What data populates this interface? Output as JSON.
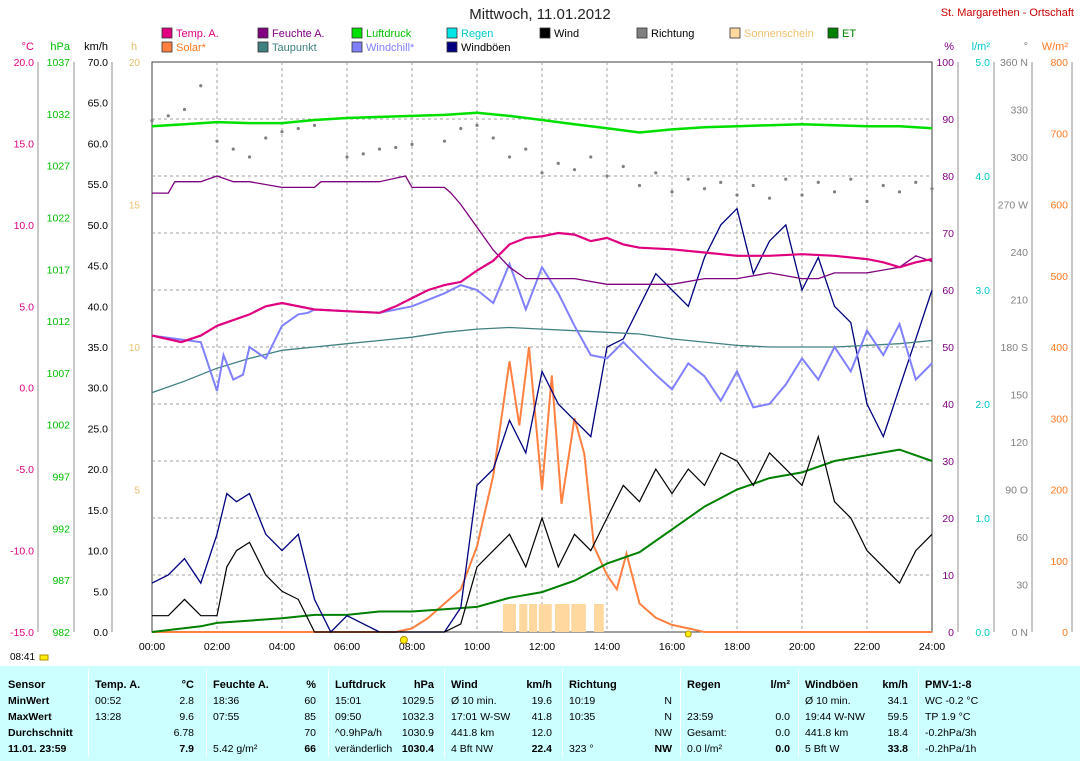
{
  "chart_data": {
    "type": "line",
    "title": "Mittwoch, 11.01.2012",
    "site": "St. Margarethen - Ortschaft",
    "x_ticks": [
      "00:00",
      "02:00",
      "04:00",
      "06:00",
      "08:00",
      "10:00",
      "12:00",
      "14:00",
      "16:00",
      "18:00",
      "20:00",
      "22:00",
      "24:00"
    ],
    "axes": {
      "temp_c": {
        "label": "°C",
        "ticks": [
          "20.0",
          "15.0",
          "10.0",
          "5.0",
          "0.0",
          "-5.0",
          "-10.0",
          "-15.0"
        ],
        "range": [
          -15,
          20
        ],
        "color": "#e0007f"
      },
      "pressure_hpa": {
        "label": "hPa",
        "ticks": [
          "1037",
          "1032",
          "1027",
          "1022",
          "1017",
          "1012",
          "1007",
          "1002",
          "997",
          "992",
          "987",
          "982"
        ],
        "range": [
          982,
          1040
        ],
        "color": "#00d000"
      },
      "wind_kmh": {
        "label": "km/h",
        "ticks": [
          "70.0",
          "65.0",
          "60.0",
          "55.0",
          "50.0",
          "45.0",
          "40.0",
          "35.0",
          "30.0",
          "25.0",
          "20.0",
          "15.0",
          "10.0",
          "5.0",
          "0.0"
        ],
        "range": [
          0,
          70
        ],
        "color": "#000000"
      },
      "sunshine": {
        "label": "h",
        "ticks": [
          "20",
          "15",
          "10",
          "5"
        ],
        "color": "#e8c070"
      },
      "humidity_pct": {
        "label": "%",
        "ticks": [
          "100",
          "90",
          "80",
          "70",
          "60",
          "50",
          "40",
          "30",
          "20",
          "10",
          "0"
        ],
        "range": [
          0,
          100
        ],
        "color": "#800080"
      },
      "rain_lm2": {
        "label": "l/m²",
        "ticks": [
          "5.0",
          "4.0",
          "3.0",
          "2.0",
          "1.0",
          "0.0"
        ],
        "range": [
          0,
          5
        ],
        "color": "#00c8c8"
      },
      "direction_deg": {
        "label": "°",
        "ticks": [
          "360 N",
          "330",
          "300",
          "270 W",
          "240",
          "210",
          "180 S",
          "150",
          "120",
          "90 O",
          "60",
          "30",
          "0 N"
        ],
        "range": [
          0,
          360
        ],
        "color": "#808080"
      },
      "solar_wm2": {
        "label": "W/m²",
        "ticks": [
          "800",
          "700",
          "600",
          "500",
          "400",
          "300",
          "200",
          "100",
          "0"
        ],
        "range": [
          0,
          800
        ],
        "color": "#ff7820"
      }
    },
    "legend": [
      {
        "name": "Temp. A.",
        "color": "#e0007f"
      },
      {
        "name": "Feuchte A.",
        "color": "#800080"
      },
      {
        "name": "Luftdruck",
        "color": "#00e000"
      },
      {
        "name": "Regen",
        "color": "#00e5e5"
      },
      {
        "name": "Wind",
        "color": "#000000"
      },
      {
        "name": "Richtung",
        "color": "#808080"
      },
      {
        "name": "Sonnenschein",
        "color": "#ffd8a0"
      },
      {
        "name": "ET",
        "color": "#008000"
      },
      {
        "name": "Solar*",
        "color": "#ff8040"
      },
      {
        "name": "Taupunkt",
        "color": "#408080"
      },
      {
        "name": "Windchill*",
        "color": "#8080ff"
      },
      {
        "name": "Windböen",
        "color": "#000080"
      }
    ],
    "series": [
      {
        "name": "Temp. A.",
        "unit": "°C",
        "x": [
          0,
          0.9,
          1.5,
          2,
          3,
          3.5,
          4,
          5,
          6,
          7,
          7.5,
          8,
          8.5,
          9,
          9.5,
          10,
          10.5,
          11,
          11.5,
          12,
          12.5,
          13,
          13.5,
          14,
          14.5,
          15,
          16,
          17,
          18,
          19,
          20,
          21,
          22,
          22.5,
          23,
          23.5,
          24
        ],
        "y": [
          3.2,
          2.8,
          3.2,
          3.8,
          4.5,
          5.0,
          5.2,
          4.8,
          4.7,
          4.6,
          5.0,
          5.5,
          6.0,
          6.3,
          6.5,
          7.2,
          7.8,
          8.8,
          9.2,
          9.3,
          9.5,
          9.4,
          9.0,
          9.2,
          8.8,
          8.6,
          8.5,
          8.3,
          8.1,
          8.1,
          8.2,
          8.1,
          7.9,
          7.7,
          7.4,
          7.7,
          7.9
        ]
      },
      {
        "name": "Feuchte A.",
        "unit": "%",
        "x": [
          0,
          0.5,
          0.7,
          1.5,
          2,
          2.5,
          3,
          4,
          5,
          5.2,
          5.5,
          6,
          7,
          7.8,
          8,
          8.5,
          9,
          9.2,
          9.5,
          10,
          10.5,
          11,
          11.5,
          12,
          13,
          14,
          15,
          16,
          17,
          18,
          19,
          20,
          20.5,
          21,
          22,
          23,
          23.5,
          24
        ],
        "y": [
          77,
          77,
          79,
          79,
          80,
          79,
          79,
          78,
          78,
          79,
          79,
          79,
          79,
          80,
          78,
          78,
          78,
          77,
          75,
          71,
          67,
          64,
          62,
          62,
          62,
          61,
          61,
          61,
          62,
          62,
          63,
          62,
          62,
          63,
          63,
          64,
          66,
          65
        ]
      },
      {
        "name": "Luftdruck",
        "unit": "hPa",
        "x": [
          0,
          1,
          2,
          3,
          4,
          5,
          6,
          7,
          8,
          9,
          10,
          11,
          12,
          13,
          14,
          15,
          16,
          17,
          18,
          19,
          20,
          21,
          22,
          23,
          24
        ],
        "y": [
          1030.8,
          1031.0,
          1031.2,
          1031.1,
          1031.1,
          1031.4,
          1031.6,
          1031.7,
          1031.8,
          1031.9,
          1032.1,
          1031.8,
          1031.4,
          1031.0,
          1030.6,
          1030.2,
          1030.5,
          1030.7,
          1030.8,
          1030.9,
          1031.0,
          1030.9,
          1030.8,
          1030.8,
          1030.6
        ]
      },
      {
        "name": "Taupunkt",
        "unit": "°C",
        "x": [
          0,
          1,
          2,
          3,
          4,
          5,
          6,
          7,
          8,
          9,
          10,
          11,
          12,
          13,
          14,
          15,
          16,
          17,
          18,
          19,
          20,
          21,
          22,
          23,
          24
        ],
        "y": [
          -0.3,
          0.4,
          1.2,
          1.8,
          2.3,
          2.5,
          2.7,
          2.9,
          3.1,
          3.4,
          3.6,
          3.7,
          3.6,
          3.5,
          3.4,
          3.3,
          3.0,
          2.8,
          2.6,
          2.5,
          2.5,
          2.5,
          2.6,
          2.7,
          2.9
        ]
      },
      {
        "name": "Windchill*",
        "unit": "°C",
        "x": [
          0,
          1.5,
          2,
          2.2,
          2.5,
          2.8,
          3,
          3.5,
          4,
          4.5,
          4.8,
          5,
          6,
          7,
          8,
          9,
          9.5,
          10,
          10.5,
          11,
          11.5,
          12,
          12.5,
          13,
          13.5,
          14,
          14.5,
          15,
          15.5,
          16,
          16.5,
          17,
          17.5,
          18,
          18.5,
          19,
          19.5,
          20,
          20.5,
          21,
          21.5,
          22,
          22.5,
          23,
          23.5,
          24
        ],
        "y": [
          3.2,
          2.8,
          -0.2,
          2.0,
          0.5,
          0.8,
          2.5,
          1.8,
          3.8,
          4.5,
          4.6,
          4.8,
          4.7,
          4.6,
          5.0,
          5.8,
          6.3,
          6.0,
          5.2,
          7.6,
          4.8,
          7.4,
          5.8,
          3.8,
          2.0,
          1.8,
          2.8,
          1.8,
          0.8,
          -0.1,
          1.5,
          0.7,
          -0.8,
          1.0,
          -1.2,
          -1.0,
          0.2,
          1.8,
          0.5,
          2.5,
          1.0,
          3.5,
          2.0,
          3.9,
          0.5,
          1.5
        ]
      },
      {
        "name": "Wind",
        "unit": "km/h",
        "x": [
          0,
          0.5,
          1,
          1.5,
          2,
          2.3,
          2.6,
          3,
          3.5,
          4,
          4.5,
          5,
          5.5,
          6,
          7,
          8,
          9,
          9.5,
          10,
          10.5,
          11,
          11.5,
          12,
          12.5,
          13,
          13.5,
          14,
          14.5,
          15,
          15.5,
          16,
          16.5,
          17,
          17.5,
          18,
          18.5,
          19,
          19.5,
          20,
          20.5,
          21,
          21.5,
          22,
          22.5,
          23,
          23.5,
          24
        ],
        "y": [
          2,
          2,
          4,
          2,
          2,
          8,
          10,
          11,
          7,
          5,
          4,
          0,
          0,
          0,
          0,
          0,
          0,
          1,
          8,
          10,
          12,
          8,
          14,
          8,
          12,
          10,
          14,
          18,
          16,
          20,
          17,
          20,
          18,
          22,
          21,
          18,
          22,
          20,
          18,
          24,
          16,
          14,
          10,
          8,
          6,
          10,
          12
        ]
      },
      {
        "name": "Windböen",
        "unit": "km/h",
        "x": [
          0,
          0.5,
          1,
          1.5,
          2,
          2.3,
          2.6,
          3,
          3.5,
          4,
          4.5,
          5,
          5.5,
          6,
          7,
          8,
          9,
          9.5,
          10,
          10.5,
          11,
          11.5,
          12,
          12.5,
          13,
          13.5,
          14,
          14.5,
          15,
          15.5,
          16,
          16.5,
          17,
          17.5,
          18,
          18.5,
          19,
          19.5,
          20,
          20.5,
          21,
          21.5,
          22,
          22.5,
          23,
          23.5,
          24
        ],
        "y": [
          6,
          7,
          9,
          6,
          12,
          17,
          16,
          17,
          12,
          10,
          12,
          4,
          0,
          2,
          0,
          0,
          0,
          3,
          18,
          20,
          26,
          22,
          32,
          28,
          26,
          24,
          35,
          36,
          40,
          44,
          42,
          40,
          46,
          50,
          52,
          44,
          48,
          50,
          42,
          46,
          40,
          38,
          28,
          24,
          30,
          36,
          42
        ]
      },
      {
        "name": "Richtung",
        "unit": "°",
        "x": [
          0,
          0.5,
          1,
          1.5,
          2,
          2.5,
          3,
          3.5,
          4,
          4.5,
          5,
          6,
          6.5,
          7,
          7.5,
          8,
          9,
          9.5,
          10,
          10.5,
          11,
          11.5,
          12,
          12.5,
          13,
          13.5,
          14,
          14.5,
          15,
          15.5,
          16,
          16.5,
          17,
          17.5,
          18,
          18.5,
          19,
          19.5,
          20,
          20.5,
          21,
          21.5,
          22,
          22.5,
          23,
          23.5,
          24
        ],
        "y": [
          323,
          326,
          330,
          345,
          310,
          305,
          300,
          312,
          316,
          318,
          320,
          300,
          302,
          305,
          306,
          308,
          310,
          318,
          320,
          312,
          300,
          305,
          290,
          296,
          292,
          300,
          288,
          294,
          282,
          290,
          278,
          286,
          280,
          284,
          276,
          282,
          274,
          286,
          276,
          284,
          278,
          286,
          272,
          282,
          278,
          284,
          280
        ]
      },
      {
        "name": "Solar*",
        "unit": "W/m²",
        "x": [
          0,
          7.5,
          8,
          8.5,
          9,
          9.5,
          10,
          10.5,
          11,
          11.3,
          11.6,
          12,
          12.3,
          12.6,
          13,
          13.3,
          13.6,
          14,
          14.3,
          14.6,
          15,
          15.5,
          16,
          16.5,
          17,
          18,
          24
        ],
        "y": [
          0,
          0,
          5,
          20,
          40,
          60,
          120,
          220,
          380,
          290,
          400,
          200,
          360,
          180,
          300,
          250,
          120,
          80,
          60,
          110,
          40,
          20,
          10,
          5,
          0,
          0,
          0
        ]
      },
      {
        "name": "ET",
        "unit": "l/m²",
        "x": [
          0,
          1.5,
          2,
          3,
          4,
          5,
          6,
          7,
          8,
          9,
          10,
          11,
          12,
          13,
          14,
          15,
          16,
          17,
          18,
          19,
          20,
          21,
          22,
          23,
          24
        ],
        "y": [
          0,
          0.05,
          0.08,
          0.1,
          0.12,
          0.15,
          0.15,
          0.18,
          0.18,
          0.2,
          0.22,
          0.3,
          0.35,
          0.45,
          0.6,
          0.7,
          0.9,
          1.1,
          1.25,
          1.35,
          1.4,
          1.5,
          1.55,
          1.6,
          1.5
        ]
      }
    ],
    "sunshine_bars": {
      "start_hours": [
        10.8,
        11.0,
        11.3,
        11.6,
        11.9,
        12.4,
        12.9,
        13.6
      ],
      "width_hours": [
        0.2,
        0.2,
        0.25,
        0.25,
        0.4,
        0.45,
        0.45,
        0.3
      ]
    }
  },
  "timestamp": "08:41",
  "stats": {
    "sensor": {
      "title": "Sensor",
      "rows": [
        "MinWert",
        "MaxWert",
        "Durchschnitt",
        "11.01. 23:59"
      ]
    },
    "temp": {
      "title": "Temp. A.",
      "unit": "°C",
      "rows": [
        [
          "00:52",
          "2.8"
        ],
        [
          "13:28",
          "9.6"
        ],
        [
          "",
          "6.78"
        ],
        [
          "",
          "7.9"
        ]
      ]
    },
    "feuchte": {
      "title": "Feuchte A.",
      "unit": "%",
      "rows": [
        [
          "18:36",
          "60"
        ],
        [
          "07:55",
          "85"
        ],
        [
          "",
          "70"
        ],
        [
          "5.42 g/m²",
          "66"
        ]
      ]
    },
    "luftdruck": {
      "title": "Luftdruck",
      "unit": "hPa",
      "rows": [
        [
          "15:01",
          "1029.5"
        ],
        [
          "09:50",
          "1032.3"
        ],
        [
          "^0.9hPa/h",
          "1030.9"
        ],
        [
          "veränderlich",
          "1030.4"
        ]
      ]
    },
    "wind": {
      "title": "Wind",
      "unit": "km/h",
      "rows": [
        [
          "Ø 10 min.",
          "19.6"
        ],
        [
          "17:01  W-SW",
          "41.8"
        ],
        [
          "441.8 km",
          "12.0"
        ],
        [
          "4 Bft NW",
          "22.4"
        ]
      ]
    },
    "richtung": {
      "title": "Richtung",
      "unit": "",
      "rows": [
        [
          "10:19",
          "N"
        ],
        [
          "10:35",
          "N"
        ],
        [
          "",
          "NW"
        ],
        [
          "323 °",
          "NW"
        ]
      ]
    },
    "regen": {
      "title": "Regen",
      "unit": "l/m²",
      "rows": [
        [
          "",
          ""
        ],
        [
          "23:59",
          "0.0"
        ],
        [
          "Gesamt:",
          "0.0"
        ],
        [
          "0.0 l/m²",
          "0.0"
        ]
      ]
    },
    "windboeen": {
      "title": "Windböen",
      "unit": "km/h",
      "rows": [
        [
          "Ø 10 min.",
          "34.1"
        ],
        [
          "19:44  W-NW",
          "59.5"
        ],
        [
          "441.8 km",
          "18.4"
        ],
        [
          "5 Bft W",
          "33.8"
        ]
      ]
    },
    "pmv": {
      "title": "PMV-1:-8",
      "rows": [
        "WC -0.2 °C",
        "TP 1.9 °C",
        "-0.2hPa/3h",
        "-0.2hPa/1h"
      ]
    }
  }
}
